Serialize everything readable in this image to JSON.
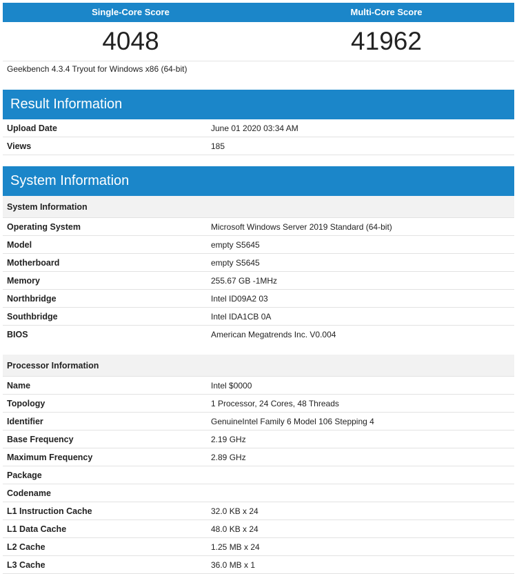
{
  "scores": {
    "single_label": "Single-Core Score",
    "multi_label": "Multi-Core Score",
    "single_value": "4048",
    "multi_value": "41962"
  },
  "version": "Geekbench 4.3.4 Tryout for Windows x86 (64-bit)",
  "result": {
    "title": "Result Information",
    "rows": [
      {
        "k": "Upload Date",
        "v": "June 01 2020 03:34 AM"
      },
      {
        "k": "Views",
        "v": "185"
      }
    ]
  },
  "system": {
    "title": "System Information",
    "section1": {
      "title": "System Information",
      "rows": [
        {
          "k": "Operating System",
          "v": "Microsoft Windows Server 2019 Standard (64-bit)"
        },
        {
          "k": "Model",
          "v": "empty S5645"
        },
        {
          "k": "Motherboard",
          "v": "empty S5645"
        },
        {
          "k": "Memory",
          "v": "255.67 GB -1MHz"
        },
        {
          "k": "Northbridge",
          "v": "Intel ID09A2 03"
        },
        {
          "k": "Southbridge",
          "v": "Intel IDA1CB 0A"
        },
        {
          "k": "BIOS",
          "v": "American Megatrends Inc. V0.004"
        }
      ]
    },
    "section2": {
      "title": "Processor Information",
      "rows": [
        {
          "k": "Name",
          "v": "Intel $0000"
        },
        {
          "k": "Topology",
          "v": "1 Processor, 24 Cores, 48 Threads"
        },
        {
          "k": "Identifier",
          "v": "GenuineIntel Family 6 Model 106 Stepping 4"
        },
        {
          "k": "Base Frequency",
          "v": "2.19 GHz"
        },
        {
          "k": "Maximum Frequency",
          "v": "2.89 GHz"
        },
        {
          "k": "Package",
          "v": ""
        },
        {
          "k": "Codename",
          "v": ""
        },
        {
          "k": "L1 Instruction Cache",
          "v": "32.0 KB x 24"
        },
        {
          "k": "L1 Data Cache",
          "v": "48.0 KB x 24"
        },
        {
          "k": "L2 Cache",
          "v": "1.25 MB x 24"
        },
        {
          "k": "L3 Cache",
          "v": "36.0 MB x 1"
        }
      ]
    }
  }
}
